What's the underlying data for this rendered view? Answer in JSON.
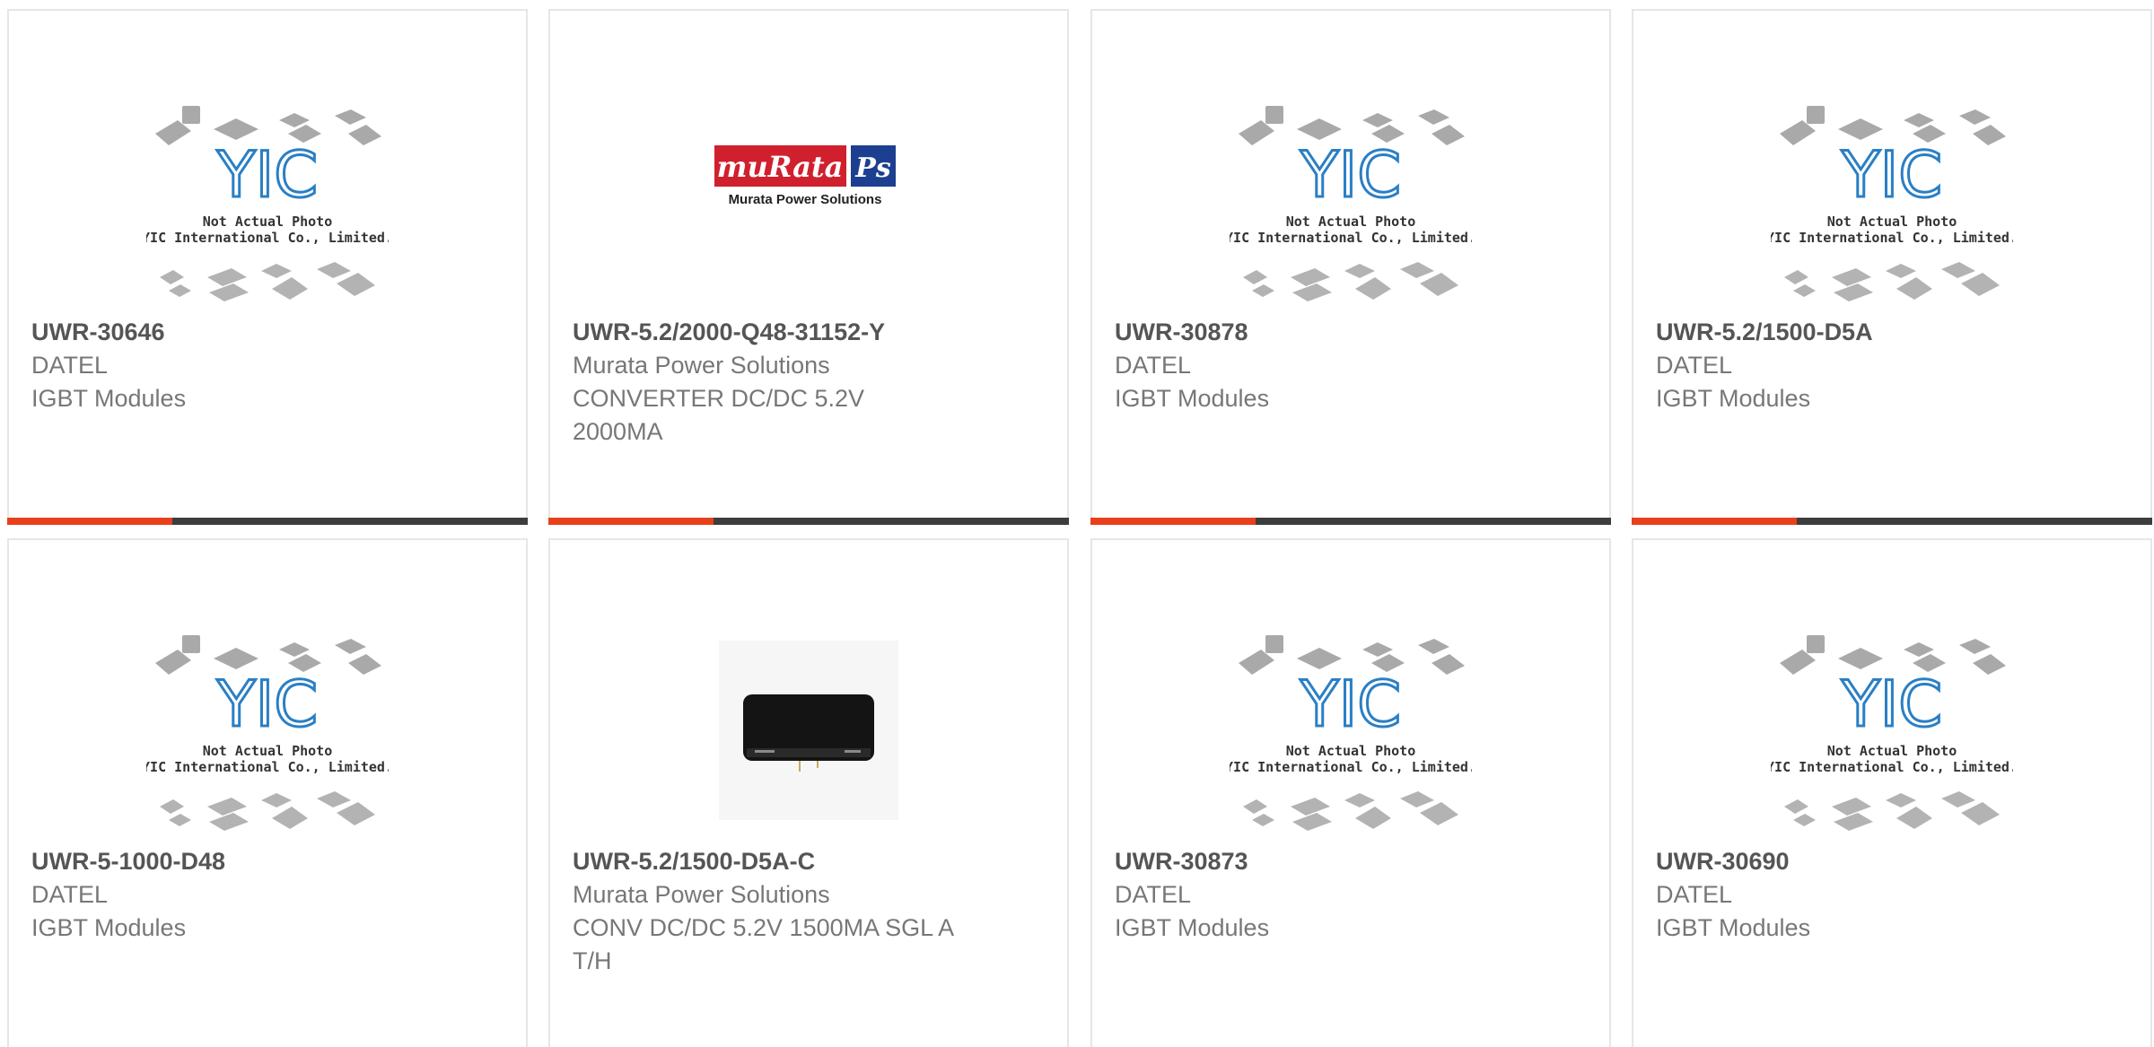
{
  "colors": {
    "accent": "#e8401b",
    "bar": "#3d3d3d",
    "yic_blue": "#2a7fc4",
    "text_bold": "#555555",
    "text": "#777777"
  },
  "placeholder": {
    "line1": "Not Actual Photo",
    "line2": "YIC International Co., Limited.",
    "logo": "YIC"
  },
  "murata_logo": {
    "brand": "muRata",
    "badge": "Ps",
    "tagline": "Murata Power Solutions"
  },
  "products": [
    {
      "part": "UWR-30646",
      "manufacturer": "DATEL",
      "description": "IGBT Modules",
      "image": "placeholder"
    },
    {
      "part": "UWR-5.2/2000-Q48-31152-Y",
      "manufacturer": "Murata Power Solutions",
      "description": "CONVERTER DC/DC 5.2V 2000MA",
      "image": "murata-logo"
    },
    {
      "part": "UWR-30878",
      "manufacturer": "DATEL",
      "description": "IGBT Modules",
      "image": "placeholder"
    },
    {
      "part": "UWR-5.2/1500-D5A",
      "manufacturer": "DATEL",
      "description": "IGBT Modules",
      "image": "placeholder"
    },
    {
      "part": "UWR-5-1000-D48",
      "manufacturer": "DATEL",
      "description": "IGBT Modules",
      "image": "placeholder"
    },
    {
      "part": "UWR-5.2/1500-D5A-C",
      "manufacturer": "Murata Power Solutions",
      "description": "CONV DC/DC 5.2V 1500MA SGL A T/H",
      "image": "product-photo"
    },
    {
      "part": "UWR-30873",
      "manufacturer": "DATEL",
      "description": "IGBT Modules",
      "image": "placeholder"
    },
    {
      "part": "UWR-30690",
      "manufacturer": "DATEL",
      "description": "IGBT Modules",
      "image": "placeholder"
    }
  ]
}
